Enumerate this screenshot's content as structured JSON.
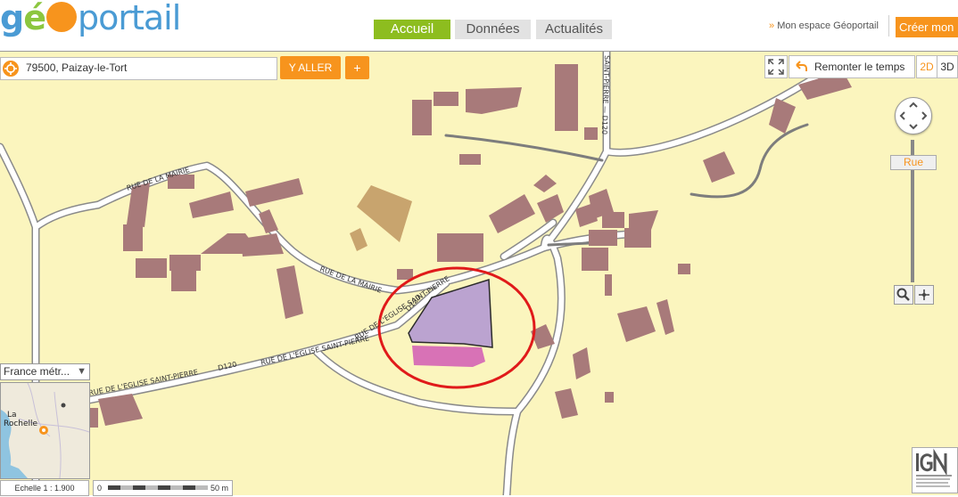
{
  "header": {
    "logo": {
      "g": "g",
      "e": "é",
      "o": "o",
      "portail": "portail"
    },
    "nav": [
      {
        "label": "Accueil",
        "active": true
      },
      {
        "label": "Données",
        "active": false
      },
      {
        "label": "Actualités",
        "active": false
      }
    ],
    "espace_chevron": "»",
    "espace_label": "Mon espace Géoportail",
    "creer_label": "Créer mon"
  },
  "search": {
    "value": "79500, Paizay-le-Tort",
    "go_label": "Y ALLER",
    "plus_label": "+"
  },
  "toolbar": {
    "remonter_label": "Remonter le temps",
    "mode_2d": "2D",
    "mode_3d": "3D"
  },
  "zoom": {
    "level_label": "Rue"
  },
  "layers": {
    "selected": "France métr...",
    "arrow": "▼"
  },
  "minimap": {
    "city_line1": "La",
    "city_line2": "Rochelle"
  },
  "scale": {
    "label": "Echelle 1 :  1.900",
    "start": "0",
    "end": "50 m"
  },
  "roads": [
    {
      "label": "RUE DE LA MAIRIE"
    },
    {
      "label": "RUE DE LA MAIRIE"
    },
    {
      "label": "D120"
    },
    {
      "label": "RUE DE L'EGLISE SAINT-PIERRE"
    },
    {
      "label": "D120"
    },
    {
      "label": "RUE DE L'EGLISE SAINT-PIERRE"
    },
    {
      "label": "RUE DE L'EGLISE SAINT-PIERRE"
    },
    {
      "label": "SAINT-PIERRE — D120"
    }
  ],
  "colors": {
    "map_bg": "#fbf5be",
    "building": "#a87a7a",
    "highlight_purple": "#bba3d0",
    "highlight_pink": "#d872b6",
    "annotation_circle": "#e01a1a",
    "accent_orange": "#f7941d",
    "nav_green": "#8dbd1f"
  }
}
